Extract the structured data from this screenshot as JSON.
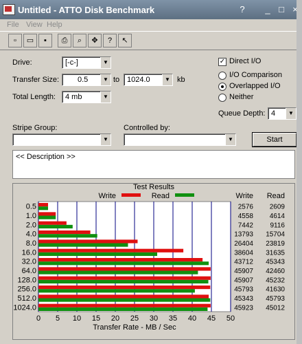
{
  "window": {
    "title": "Untitled - ATTO Disk Benchmark",
    "buttons": [
      "?",
      "_",
      "□",
      "×"
    ]
  },
  "menu": [
    "File",
    "View",
    "Help"
  ],
  "toolbar": [
    "new-icon",
    "open-icon",
    "save-icon",
    "print-icon",
    "print-preview-icon",
    "move-icon",
    "help-icon",
    "context-help-icon"
  ],
  "form": {
    "drive_label": "Drive:",
    "drive_value": "[-c-]",
    "transfer_size_label": "Transfer Size:",
    "transfer_from": "0.5",
    "to_label": "to",
    "transfer_to": "1024.0",
    "kb_label": "kb",
    "total_length_label": "Total Length:",
    "total_length_value": "4 mb",
    "direct_io_label": "Direct I/O",
    "io_comparison_label": "I/O Comparison",
    "overlapped_io_label": "Overlapped I/O",
    "neither_label": "Neither",
    "queue_depth_label": "Queue Depth:",
    "queue_depth_value": "4",
    "stripe_group_label": "Stripe Group:",
    "controlled_by_label": "Controlled by:",
    "start_label": "Start",
    "description": "<< Description >>"
  },
  "results": {
    "title": "Test Results",
    "write_label": "Write",
    "read_label": "Read",
    "write_col": "Write",
    "read_col": "Read",
    "write_color": "#e01010",
    "read_color": "#109010"
  },
  "chart_data": {
    "type": "bar",
    "title": "Test Results",
    "xlabel": "Transfer Rate - MB / Sec",
    "xlim": [
      0,
      50
    ],
    "xticks": [
      0,
      5,
      10,
      15,
      20,
      25,
      30,
      35,
      40,
      45,
      50
    ],
    "categories": [
      "0.5",
      "1.0",
      "2.0",
      "4.0",
      "8.0",
      "16.0",
      "32.0",
      "64.0",
      "128.0",
      "256.0",
      "512.0",
      "1024.0"
    ],
    "series": [
      {
        "name": "Write",
        "values": [
          2.5,
          4.5,
          7.3,
          13.5,
          25.8,
          37.7,
          42.7,
          44.8,
          44.8,
          44.7,
          44.3,
          44.8
        ],
        "numbers": [
          "2576",
          "4558",
          "7442",
          "13793",
          "26404",
          "38604",
          "43712",
          "45907",
          "45907",
          "45793",
          "45343",
          "45923"
        ]
      },
      {
        "name": "Read",
        "values": [
          2.5,
          4.5,
          8.9,
          15.3,
          23.3,
          30.9,
          44.3,
          41.5,
          44.2,
          40.7,
          44.7,
          44.0
        ],
        "numbers": [
          "2609",
          "4614",
          "9116",
          "15704",
          "23819",
          "31635",
          "45343",
          "42460",
          "45232",
          "41630",
          "45793",
          "45012"
        ]
      }
    ]
  }
}
